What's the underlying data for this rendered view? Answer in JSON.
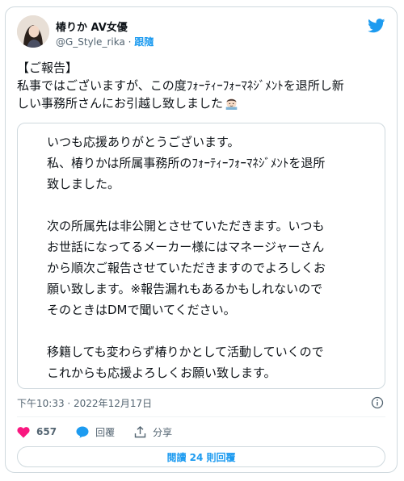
{
  "author": {
    "name": "椿りか AV女優",
    "handle": "@G_Style_rika",
    "separator": "·",
    "follow_label": "跟隨"
  },
  "tweet": {
    "lines": [
      "【ご報告】",
      "私事ではございますが、この度ﾌｫｰﾃｨｰﾌｫｰﾏﾈｼﾞﾒﾝﾄを退所し新",
      "しい事務所さんにお引越し致しました"
    ],
    "emoji": "person-gesturing-emoji"
  },
  "quote": {
    "paragraphs": [
      [
        "いつも応援ありがとうございます。",
        "私、椿りかは所属事務所のﾌｫｰﾃｨｰﾌｫｰﾏﾈｼﾞﾒﾝﾄを退所",
        "致しました。"
      ],
      [
        "次の所属先は非公開とさせていただきます。いつも",
        "お世話になってるメーカー様にはマネージャーさん",
        "から順次ご報告させていただきますのでよろしくお",
        "願い致します。※報告漏れもあるかもしれないので",
        "そのときはDMで聞いてください。"
      ],
      [
        "移籍しても変わらず椿りかとして活動していくので",
        "これからも応援よろしくお願い致します。"
      ]
    ]
  },
  "meta": {
    "timestamp": "下午10:33 · 2022年12月17日"
  },
  "actions": {
    "like_count": "657",
    "reply_label": "回覆",
    "share_label": "分享"
  },
  "read_replies_label": "閱讀 24 則回覆",
  "colors": {
    "accent": "#1d9bf0",
    "like": "#f91880",
    "text": "#0f1419",
    "muted": "#536471",
    "border": "#cfd9de"
  }
}
